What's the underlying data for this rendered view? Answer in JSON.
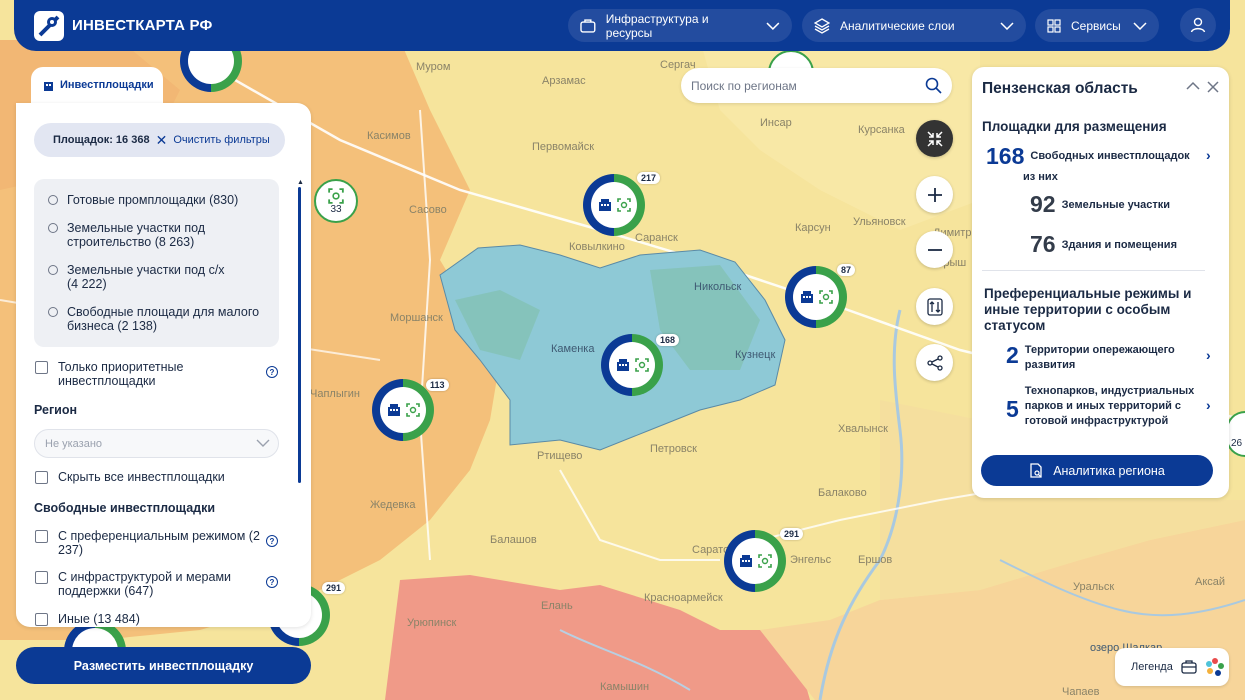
{
  "header": {
    "logo_text": "ИНВЕСТКАРТА РФ",
    "nav": [
      {
        "label": "Инфраструктура и ресурсы",
        "icon": "briefcase-icon"
      },
      {
        "label": "Аналитические слои",
        "icon": "layers-icon"
      },
      {
        "label": "Сервисы",
        "icon": "grid-icon"
      }
    ],
    "user_icon": "user-icon"
  },
  "left_panel": {
    "tab_label": "Инвестплощадки",
    "count_label": "Площадок: 16 368",
    "clear_filters": "Очистить фильтры",
    "site_types": [
      "Готовые промплощадки (830)",
      "Земельные участки под строительство (8 263)",
      "Земельные участки под с/х (4 222)",
      "Свободные площади для малого бизнеса (2 138)"
    ],
    "priority_only": "Только приоритетные инвестплощадки",
    "region_title": "Регион",
    "region_placeholder": "Не указано",
    "hide_all": "Скрыть все инвестплощадки",
    "free_title": "Свободные инвестплощадки",
    "free_filters": [
      "С преференциальным режимом (2 237)",
      "С инфраструктурой и мерами поддержки (647)",
      "Иные (13 484)"
    ],
    "place_button": "Разместить инвестплощадку"
  },
  "search": {
    "placeholder": "Поиск по регионам"
  },
  "map": {
    "accent": "#0b3a95",
    "green": "#3aa14a",
    "region_fill": "#8ec9d6",
    "cities": [
      "Муром",
      "Арзамас",
      "Сергач",
      "Касимов",
      "Первомайск",
      "Сасово",
      "Инсар",
      "Ковылкино",
      "Саранск",
      "Ульяновск",
      "Никольск",
      "Каменка",
      "Кузнецк",
      "Моршанск",
      "Чаплыгин",
      "Ртищево",
      "Петровск",
      "Жедевка",
      "Хвалынск",
      "Балаково",
      "Балашов",
      "Саратов",
      "Энгельс",
      "Ершов",
      "Елань",
      "Урюпинск",
      "Красноармейск",
      "Камышин",
      "Уральск",
      "Аксай",
      "Чапаев",
      "Курсанка",
      "Димитровград",
      "Барыш",
      "Карсун",
      "озеро Шалкар"
    ],
    "clusters": [
      {
        "count": "217"
      },
      {
        "count": "87"
      },
      {
        "count": "168"
      },
      {
        "count": "113"
      },
      {
        "count": "291"
      },
      {
        "count": "291"
      }
    ],
    "small_cluster": "33",
    "edge_cluster": "26"
  },
  "right_panel": {
    "title": "Пензенская область",
    "section1": "Площадки для размещения",
    "free_num": "168",
    "free_label": "Свободных инвестплощадок",
    "of_which": "из них",
    "land_num": "92",
    "land_label": "Земельные участки",
    "bld_num": "76",
    "bld_label": "Здания и помещения",
    "section2": "Преференциальные режимы и иные территории с особым статусом",
    "tor_num": "2",
    "tor_label": "Территории опережающего развития",
    "tech_num": "5",
    "tech_label": "Технопарков, индустриальных парков и иных территорий с готовой инфраструктурой",
    "analytics_button": "Аналитика региона"
  },
  "legend": {
    "label": "Легенда"
  }
}
